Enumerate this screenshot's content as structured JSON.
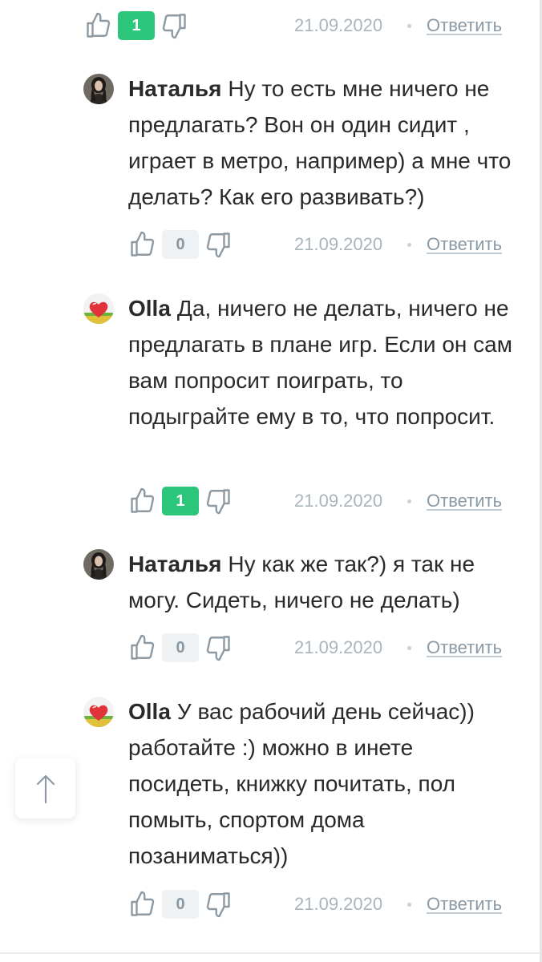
{
  "comments": [
    {
      "author": "",
      "text": "",
      "rating": "1",
      "date": "21.09.2020",
      "reply_label": "Ответить"
    },
    {
      "author": "Наталья",
      "text": "Ну то есть мне ничего не предлагать? Вон он один сидит , играет в метро, например) а мне что делать? Как его развивать?)",
      "rating": "0",
      "date": "21.09.2020",
      "reply_label": "Ответить"
    },
    {
      "author": "Olla",
      "text": "Да, ничего не делать, ничего не предлагать в плане игр. Если он сам вам попросит поиграть, то подыграйте ему в то, что попросит.",
      "rating": "1",
      "date": "21.09.2020",
      "reply_label": "Ответить"
    },
    {
      "author": "Наталья",
      "text": "Ну как же так?) я так не могу. Сидеть, ничего не делать)",
      "rating": "0",
      "date": "21.09.2020",
      "reply_label": "Ответить"
    },
    {
      "author": "Olla",
      "text": "У вас рабочий день сейчас)) работайте :) можно в инете посидеть, книжку почитать, пол помыть, спортом дома позаниматься))",
      "rating": "0",
      "date": "21.09.2020",
      "reply_label": "Ответить"
    }
  ],
  "icons": {
    "like": "thumbs-up-icon",
    "dislike": "thumbs-down-icon",
    "scroll_top": "arrow-up-icon"
  },
  "colors": {
    "positive_badge": "#2cc67a",
    "neutral_badge": "#eef2f5",
    "meta_text": "#aab4bb"
  }
}
